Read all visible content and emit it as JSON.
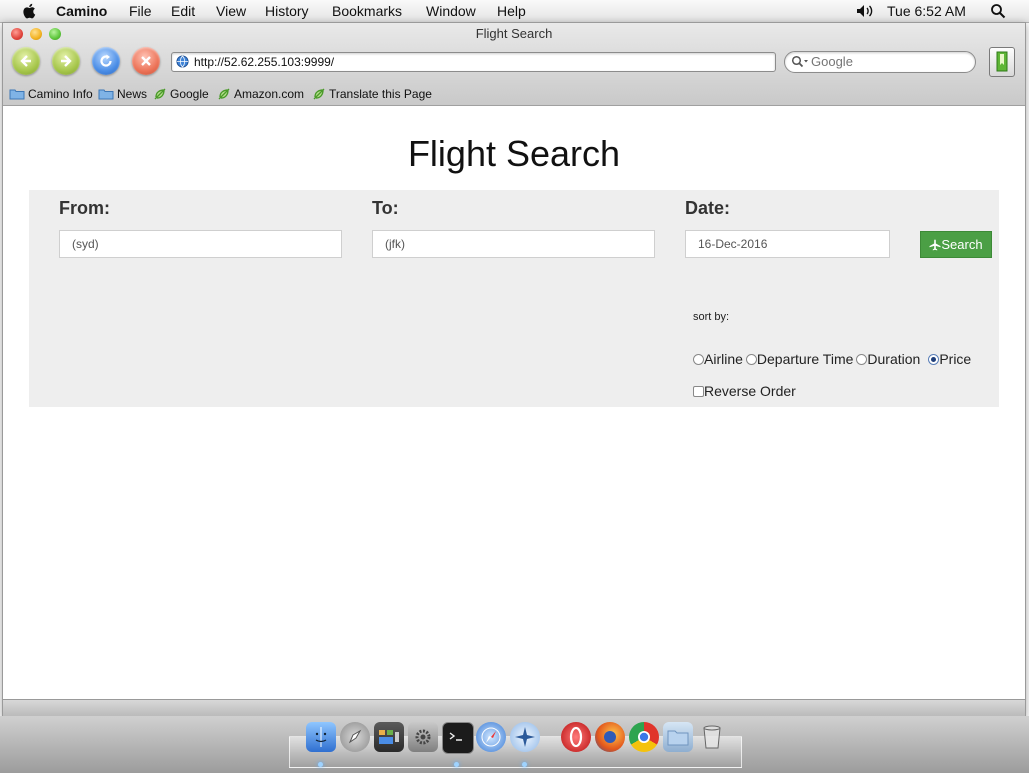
{
  "menubar": {
    "app": "Camino",
    "items": [
      "File",
      "Edit",
      "View",
      "History",
      "Bookmarks",
      "Window",
      "Help"
    ],
    "clock": "Tue 6:52 AM"
  },
  "window": {
    "title": "Flight Search",
    "url": "http://52.62.255.103:9999/",
    "search_placeholder": "Google"
  },
  "bookmarks": [
    "Camino Info",
    "News",
    "Google",
    "Amazon.com",
    "Translate this Page"
  ],
  "page": {
    "title": "Flight Search",
    "from": {
      "label": "From:",
      "value": "(syd)"
    },
    "to": {
      "label": "To:",
      "value": "(jfk)"
    },
    "date": {
      "label": "Date:",
      "value": "16-Dec-2016"
    },
    "search_button": "Search",
    "sort_label": "sort by:",
    "sort_options": [
      {
        "label": "Airline",
        "checked": false
      },
      {
        "label": "Departure Time",
        "checked": false
      },
      {
        "label": "Duration",
        "checked": false
      },
      {
        "label": "Price",
        "checked": true
      }
    ],
    "reverse_label": "Reverse Order",
    "reverse_checked": false
  },
  "dock": {
    "icons": [
      "finder-icon",
      "launchpad-icon",
      "mission-control-icon",
      "system-preferences-icon",
      "terminal-icon",
      "safari-icon",
      "compass-icon",
      "opera-icon",
      "firefox-icon",
      "chrome-icon",
      "folder-icon",
      "trash-icon"
    ]
  },
  "colors": {
    "search_button": "#4b9f45",
    "panel": "#eeeeee"
  }
}
